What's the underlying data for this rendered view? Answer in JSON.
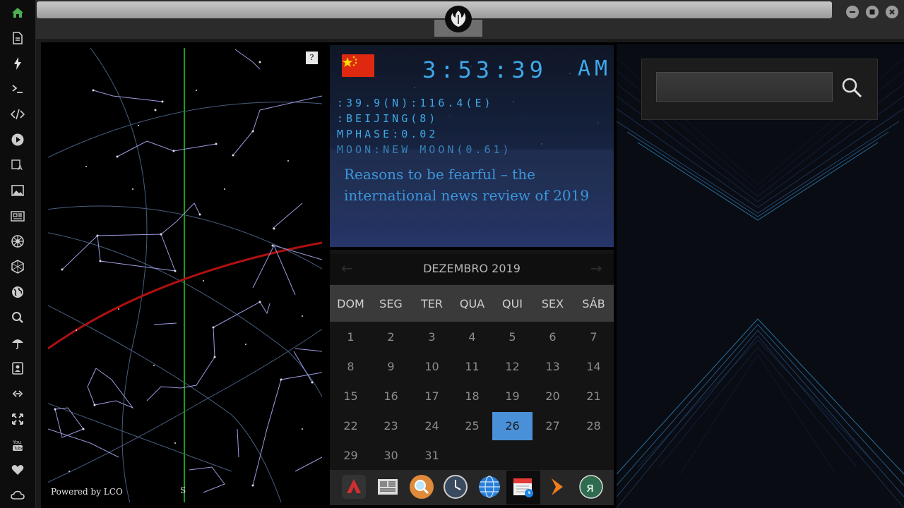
{
  "sidebar": {
    "items": [
      {
        "icon": "home-icon",
        "color": "#4caf50"
      },
      {
        "icon": "document-icon"
      },
      {
        "icon": "lightning-icon"
      },
      {
        "icon": "terminal-icon"
      },
      {
        "icon": "code-icon"
      },
      {
        "icon": "play-icon"
      },
      {
        "icon": "translate-icon"
      },
      {
        "icon": "image-icon"
      },
      {
        "icon": "newspaper-icon"
      },
      {
        "icon": "galactic-empire-icon"
      },
      {
        "icon": "hexagon-icon"
      },
      {
        "icon": "globe-icon"
      },
      {
        "icon": "search-icon"
      },
      {
        "icon": "umbrella-icon"
      },
      {
        "icon": "contacts-icon"
      },
      {
        "icon": "link-icon"
      },
      {
        "icon": "expand-icon"
      },
      {
        "icon": "youtube-icon"
      },
      {
        "icon": "heart-icon"
      },
      {
        "icon": "cloud-icon"
      }
    ]
  },
  "window": {
    "logo": "rebel-alliance-icon"
  },
  "starchart": {
    "help_label": "?",
    "powered_by": "Powered by LCO",
    "direction": "S"
  },
  "clock": {
    "time": "3:53:39",
    "ampm": "AM",
    "coords": ":39.9(N):116.4(E)",
    "city": ":BEIJING(8)",
    "mphase": "MPHASE:0.02",
    "moon": "MOON:NEW MOON(0.61)",
    "flag": "china-flag-icon"
  },
  "news": {
    "headline": "Reasons to be fearful – the international news review of 2019"
  },
  "calendar": {
    "title": "DEZEMBRO 2019",
    "weekdays": [
      "DOM",
      "SEG",
      "TER",
      "QUA",
      "QUI",
      "SEX",
      "SÁB"
    ],
    "weeks": [
      [
        "1",
        "2",
        "3",
        "4",
        "5",
        "6",
        "7"
      ],
      [
        "8",
        "9",
        "10",
        "11",
        "12",
        "13",
        "14"
      ],
      [
        "15",
        "16",
        "17",
        "18",
        "19",
        "20",
        "21"
      ],
      [
        "22",
        "23",
        "24",
        "25",
        "26",
        "27",
        "28"
      ],
      [
        "29",
        "30",
        "31"
      ]
    ],
    "today": "26",
    "accent": "#4a90d9"
  },
  "dock": {
    "apps": [
      "arch-app-icon",
      "news-reader-icon",
      "magnifier-app-icon",
      "clock-app-icon",
      "browser-globe-icon",
      "calendar-app-icon",
      "forward-arrow-icon",
      "yandex-icon"
    ]
  },
  "search": {
    "value": "",
    "placeholder": ""
  }
}
